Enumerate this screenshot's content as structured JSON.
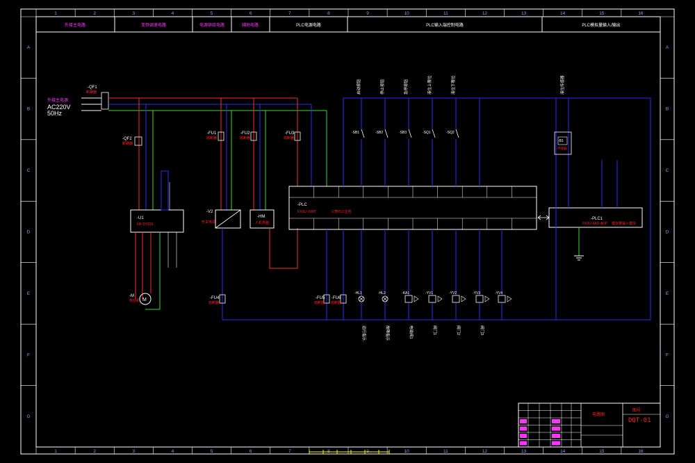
{
  "colors": {
    "background": "#000000",
    "frame": "#ffffff",
    "grid_text": "#9a9aff",
    "blue_wire": "#2a2aff",
    "green_wire": "#2fe02f",
    "red_wire": "#ff2a2a",
    "cyan_text": "#00e5e5",
    "red_text": "#ff2020",
    "magenta": "#ff33ff",
    "yellow": "#ffff00"
  },
  "border": {
    "columns": [
      "1",
      "2",
      "3",
      "4",
      "5",
      "6",
      "7",
      "8",
      "9",
      "10",
      "11",
      "12",
      "13",
      "14",
      "15",
      "16"
    ],
    "rows": [
      "A",
      "B",
      "C",
      "D",
      "E",
      "F",
      "G"
    ]
  },
  "header": {
    "cells": [
      "外接主电路",
      "变频调速电路",
      "电源供给电路",
      "辅助电路",
      "PLC电源电路",
      "PLC输入端控制电路",
      "PLC模拟量输入/输出"
    ]
  },
  "power_supply": {
    "label": "外接主电源",
    "voltage": "AC220V",
    "frequency": "50Hz",
    "breaker_tag": "-QF1",
    "breaker_name": "断路器"
  },
  "components": {
    "qf2": {
      "tag": "-QF2",
      "name": "断路器"
    },
    "fu1": {
      "tag": "-FU1",
      "name": "熔断器"
    },
    "fu2": {
      "tag": "-FU2",
      "name": "熔断器"
    },
    "fu3": {
      "tag": "-FU3",
      "name": "熔断器"
    },
    "inverter": {
      "tag": "-U1",
      "model": "FR-D720S"
    },
    "psu": {
      "tag": "-V2",
      "name": "开关电源"
    },
    "hm": {
      "tag": "-HM",
      "name": "人机界面"
    },
    "plc": {
      "tag": "-PLC",
      "model": "FX3U-16MT",
      "name": "三菱PLC主机"
    },
    "adc": {
      "tag": "-PLC1",
      "model": "FX3U-4AD-ADP",
      "name": "模拟量输入模块"
    },
    "motor": {
      "tag": "-M",
      "name": "电动机"
    },
    "fu4": {
      "tag": "-FU4",
      "name": "熔断器"
    },
    "fu5": {
      "tag": "-FU5",
      "name": "熔断器"
    },
    "fu6": {
      "tag": "-FU6",
      "name": "熔断器"
    },
    "b1": {
      "tag": "-B1",
      "name": "传感器"
    }
  },
  "inputs": {
    "labels": [
      "启动按钮",
      "停止按钮",
      "急停按钮",
      "液位上限位",
      "液位下限位"
    ],
    "tags": [
      "-SB1",
      "-SB2",
      "-SB3",
      "-SQ1",
      "-SQ2"
    ],
    "right_label": "液位传感器"
  },
  "outputs": {
    "labels": [
      "运行指示",
      "故障指示",
      "电磁阀1",
      "阀门1",
      "阀门2",
      "阀门3"
    ],
    "tags": [
      "-HL1",
      "-HL2",
      "-KA1",
      "-YV1",
      "-YV2",
      "-YV3",
      "-YV4"
    ]
  },
  "title_block": {
    "drawing_name": "电路图",
    "label": "图号",
    "number": "DQT-01"
  }
}
